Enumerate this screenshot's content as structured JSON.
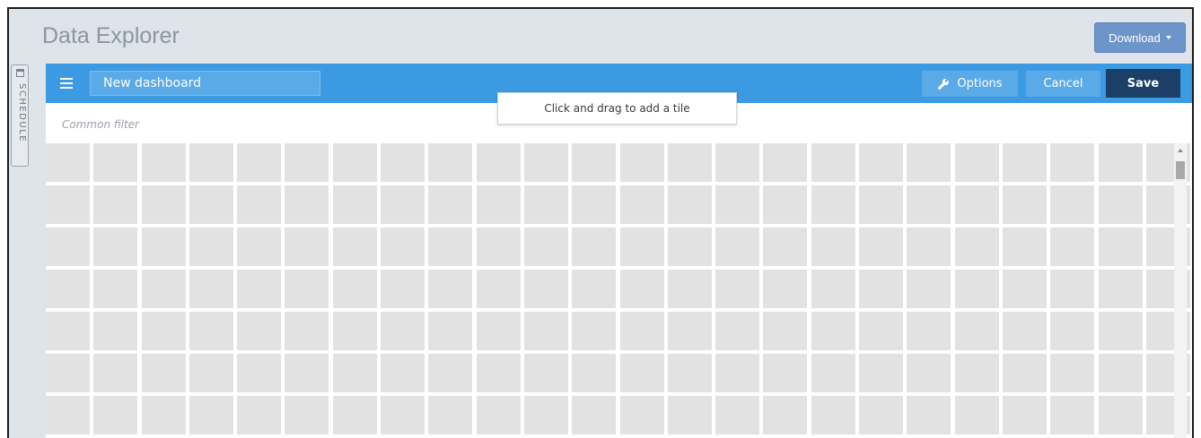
{
  "app": {
    "title": "Data Explorer"
  },
  "header": {
    "download_label": "Download",
    "download_icon": "caret-down-icon"
  },
  "sidebar": {
    "schedule_label": "SCHEDULE",
    "schedule_icon": "calendar-icon"
  },
  "toolbar": {
    "menu_icon": "hamburger-menu-icon",
    "dashboard_name": "New dashboard",
    "options_label": "Options",
    "options_icon": "wrench-icon",
    "cancel_label": "Cancel",
    "save_label": "Save",
    "accent_color": "#3c9ae2",
    "save_color": "#1b3f66"
  },
  "filter": {
    "placeholder": "Common filter"
  },
  "tooltip": {
    "text": "Click and drag to add a tile"
  },
  "grid": {
    "cell_color": "#e2e2e2"
  }
}
